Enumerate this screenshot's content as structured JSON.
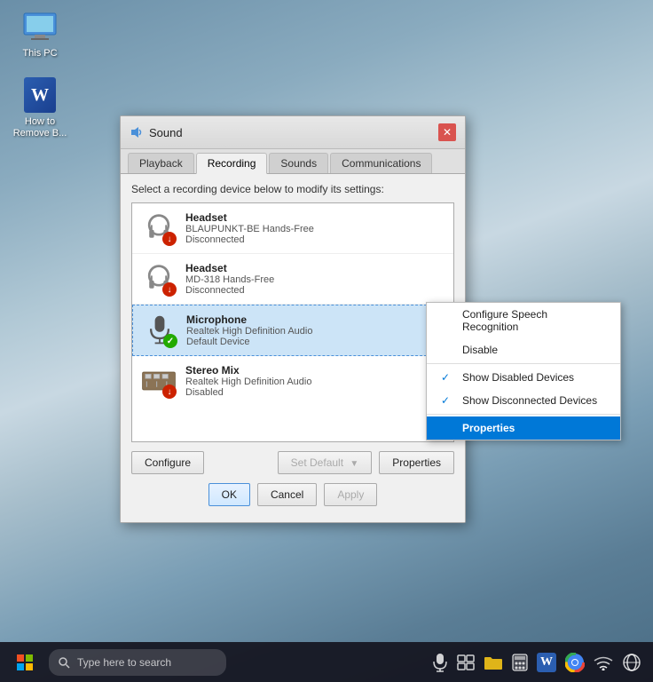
{
  "desktop": {
    "background": "mountain snow"
  },
  "desktop_icons": [
    {
      "id": "this-pc",
      "label": "This PC"
    },
    {
      "id": "word-doc",
      "label": "How to Remove B..."
    }
  ],
  "dialog": {
    "title": "Sound",
    "tabs": [
      {
        "id": "playback",
        "label": "Playback"
      },
      {
        "id": "recording",
        "label": "Recording"
      },
      {
        "id": "sounds",
        "label": "Sounds"
      },
      {
        "id": "communications",
        "label": "Communications"
      }
    ],
    "active_tab": "recording",
    "instruction": "Select a recording device below to modify its settings:",
    "devices": [
      {
        "id": "headset1",
        "name": "Headset",
        "detail": "BLAUPUNKT-BE Hands-Free",
        "status": "Disconnected",
        "icon": "headset",
        "badge": "red",
        "selected": false
      },
      {
        "id": "headset2",
        "name": "Headset",
        "detail": "MD-318 Hands-Free",
        "status": "Disconnected",
        "icon": "headset",
        "badge": "red",
        "selected": false
      },
      {
        "id": "microphone",
        "name": "Microphone",
        "detail": "Realtek High Definition Audio",
        "status": "Default Device",
        "icon": "microphone",
        "badge": "green",
        "selected": true
      },
      {
        "id": "stereo-mix",
        "name": "Stereo Mix",
        "detail": "Realtek High Definition Audio",
        "status": "Disabled",
        "icon": "circuit",
        "badge": "red",
        "selected": false
      }
    ],
    "buttons": {
      "configure": "Configure",
      "set_default": "Set Default",
      "properties": "Properties",
      "ok": "OK",
      "cancel": "Cancel",
      "apply": "Apply"
    }
  },
  "context_menu": {
    "items": [
      {
        "id": "configure-speech",
        "label": "Configure Speech Recognition",
        "checked": false,
        "highlighted": false
      },
      {
        "id": "disable",
        "label": "Disable",
        "checked": false,
        "highlighted": false
      },
      {
        "id": "show-disabled",
        "label": "Show Disabled Devices",
        "checked": true,
        "highlighted": false
      },
      {
        "id": "show-disconnected",
        "label": "Show Disconnected Devices",
        "checked": true,
        "highlighted": false
      },
      {
        "id": "properties",
        "label": "Properties",
        "checked": false,
        "highlighted": true
      }
    ]
  },
  "taskbar": {
    "search_placeholder": "Type here to search",
    "icons": [
      "microphone",
      "windows",
      "folder",
      "calculator",
      "word",
      "chrome",
      "wifi",
      "globe"
    ]
  }
}
